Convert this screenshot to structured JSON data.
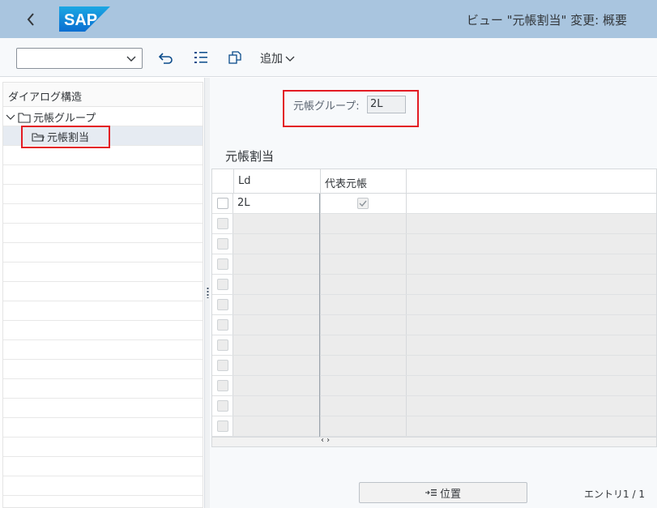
{
  "shell": {
    "title": "ビュー \"元帳割当\" 変更: 概要",
    "logo_text": "SAP",
    "brand_color": "#0a6ed1"
  },
  "toolbar": {
    "command_field_value": "",
    "add_label": "追加"
  },
  "left_panel": {
    "header": "ダイアログ構造",
    "tree": [
      {
        "label": "元帳グループ",
        "expanded": true
      },
      {
        "label": "元帳割当",
        "selected": true
      }
    ]
  },
  "main": {
    "group_label": "元帳グループ:",
    "group_value": "2L",
    "section_title": "元帳割当",
    "table": {
      "columns": [
        "Ld",
        "代表元帳"
      ],
      "rows": [
        {
          "ld": "2L",
          "representative": true,
          "editable": true
        }
      ],
      "empty_rows": 11
    },
    "position_button": "位置",
    "entry_text": "エントリ1 / 1",
    "scroll_arrows": "‹ ›"
  },
  "colors": {
    "shell_bg": "#a9c5df",
    "highlight_red": "#e31b23"
  }
}
